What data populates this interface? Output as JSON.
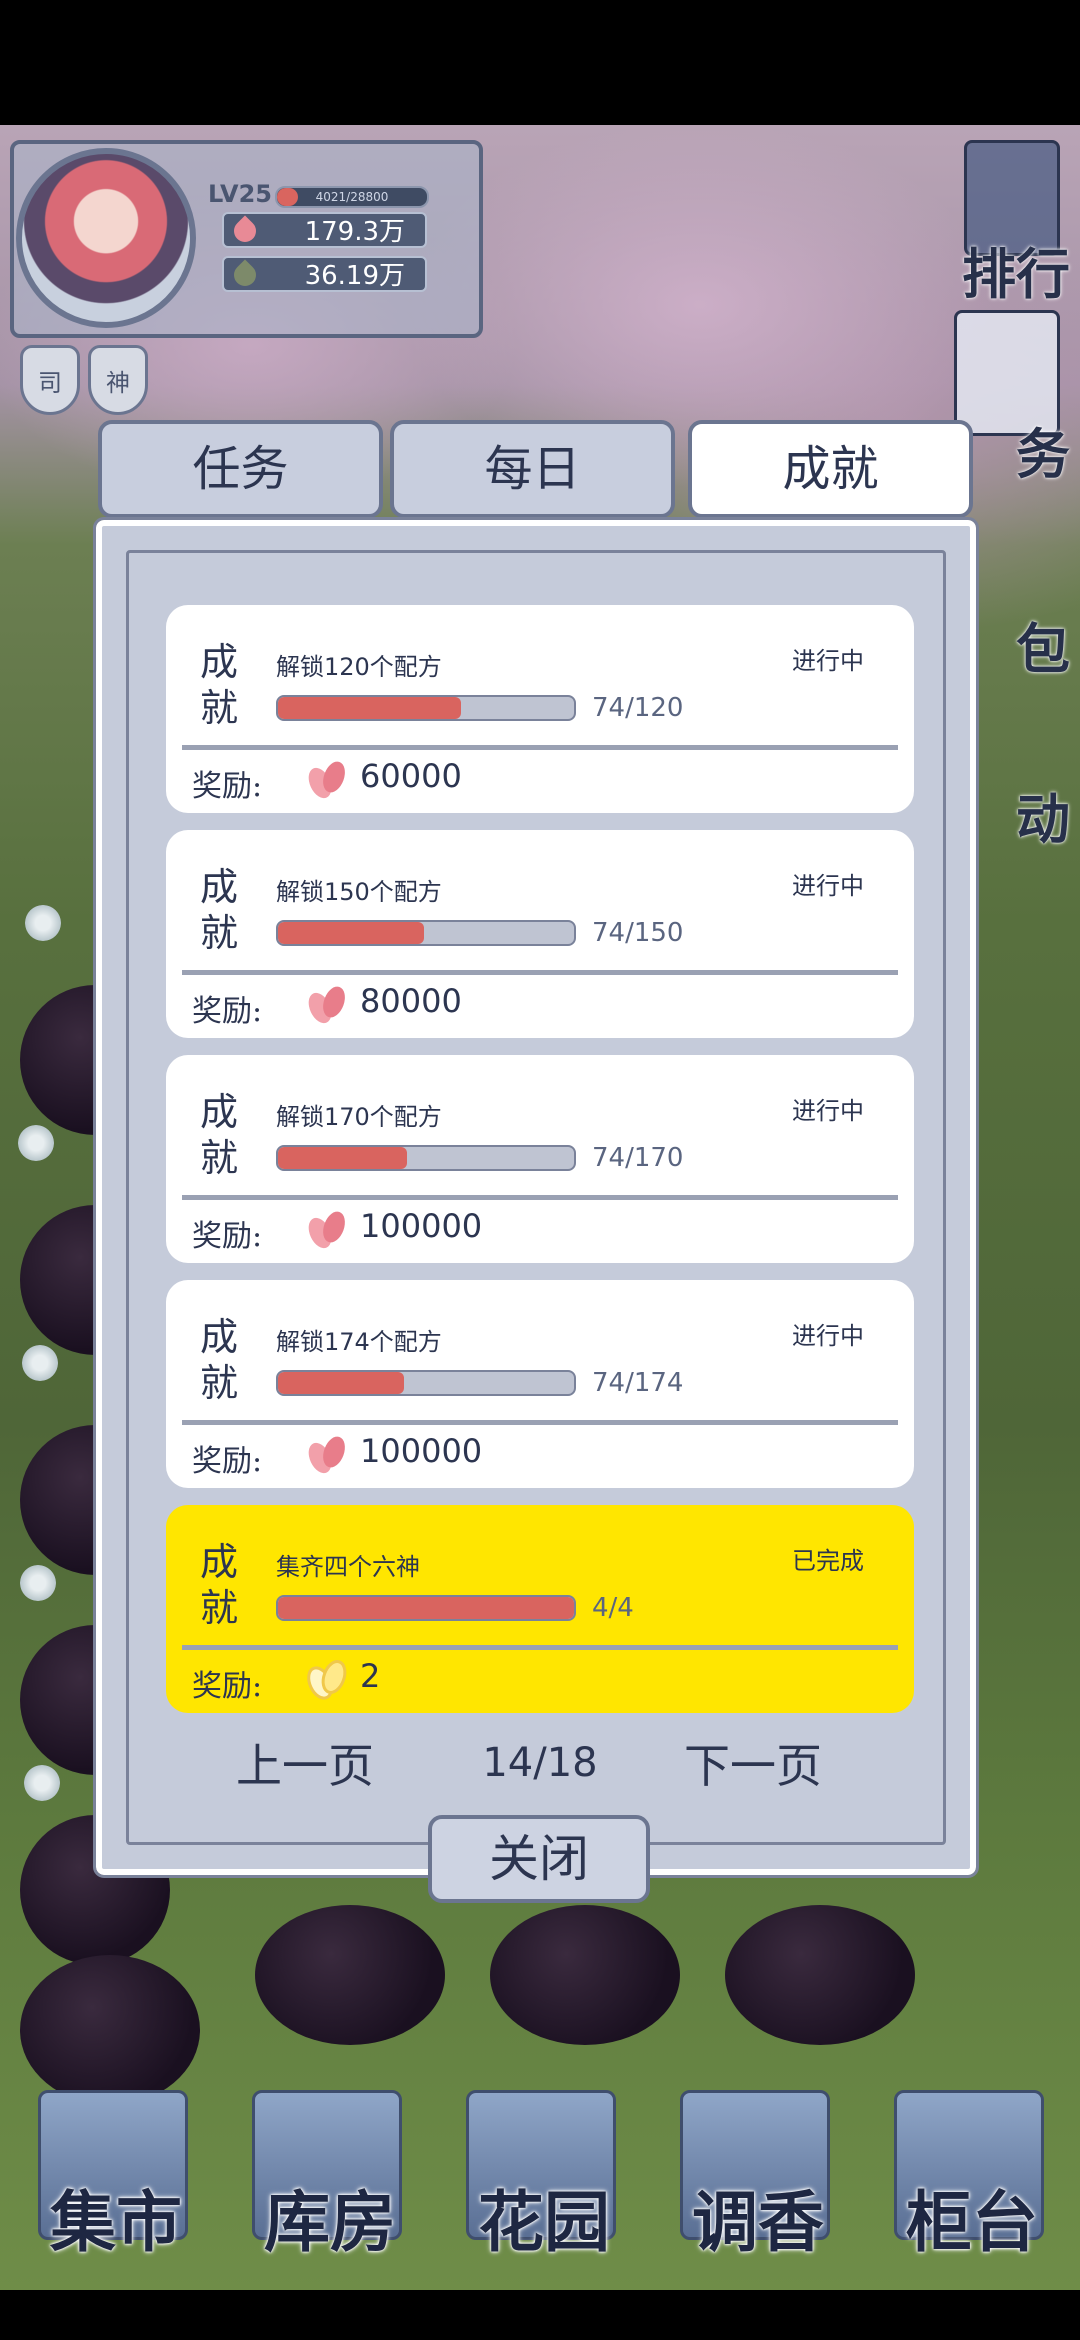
{
  "player": {
    "level": "LV25",
    "xp_text": "4021/28800",
    "xp_fraction": 0.14,
    "petals": "179.3万",
    "seeds": "36.19万",
    "badges": [
      "司",
      "神"
    ]
  },
  "right_menu": [
    "排行",
    "务",
    "包",
    "动"
  ],
  "tabs": [
    {
      "label": "任务",
      "active": false
    },
    {
      "label": "每日",
      "active": false
    },
    {
      "label": "成就",
      "active": true
    }
  ],
  "achievements": [
    {
      "label": "成就",
      "title": "解锁120个配方",
      "status": "进行中",
      "progress": "74/120",
      "fraction": 0.617,
      "reward_label": "奖励:",
      "reward": "60000",
      "done": false
    },
    {
      "label": "成就",
      "title": "解锁150个配方",
      "status": "进行中",
      "progress": "74/150",
      "fraction": 0.493,
      "reward_label": "奖励:",
      "reward": "80000",
      "done": false
    },
    {
      "label": "成就",
      "title": "解锁170个配方",
      "status": "进行中",
      "progress": "74/170",
      "fraction": 0.435,
      "reward_label": "奖励:",
      "reward": "100000",
      "done": false
    },
    {
      "label": "成就",
      "title": "解锁174个配方",
      "status": "进行中",
      "progress": "74/174",
      "fraction": 0.425,
      "reward_label": "奖励:",
      "reward": "100000",
      "done": false
    },
    {
      "label": "成就",
      "title": "集齐四个六神",
      "status": "已完成",
      "progress": "4/4",
      "fraction": 1.0,
      "reward_label": "奖励:",
      "reward": "2",
      "done": true
    }
  ],
  "pager": {
    "prev": "上一页",
    "page": "14/18",
    "next": "下一页"
  },
  "close_label": "关闭",
  "bottom_nav": [
    "集市",
    "库房",
    "花园",
    "调香",
    "柜台"
  ],
  "colors": {
    "accent_red": "#d9645f",
    "done_yellow": "#ffe600",
    "ink": "#2c3550"
  }
}
